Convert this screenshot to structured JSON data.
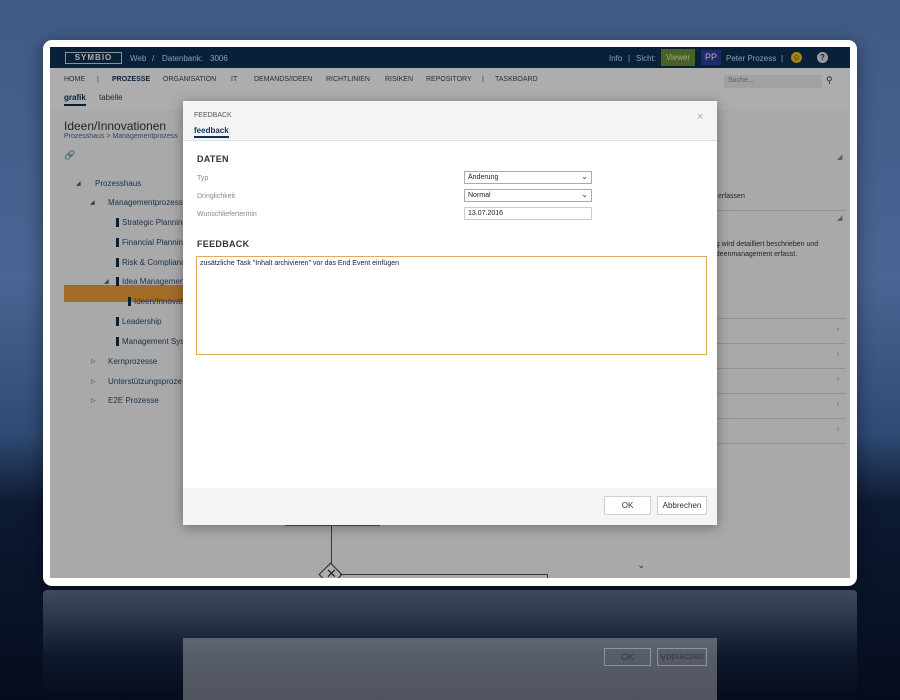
{
  "topbar": {
    "logo": "SYMBIO",
    "web": "Web",
    "separator": "/",
    "database": "Datenbank:",
    "database_id": "3006",
    "info": "Info",
    "view_label": "Sicht:",
    "view_value": "Viewer",
    "user_initials": "PP",
    "user_name": "Peter Prozess",
    "pipe": "|",
    "help": "?"
  },
  "nav": {
    "items": [
      "HOME",
      "PROZESSE",
      "ORGANISATION",
      "IT",
      "DEMANDS/IDEEN",
      "RICHTLINIEN",
      "RISIKEN",
      "REPOSITORY",
      "TASKBOARD"
    ],
    "separator": "|",
    "search_placeholder": "Suche...",
    "subtabs": [
      "grafik",
      "tabelle"
    ]
  },
  "page": {
    "title": "Ideen/Innovationen",
    "breadcrumb": "Prozesshaus > Managementprozess",
    "tree": [
      "Prozesshaus",
      "Managementprozesse",
      "Strategic Planning",
      "Financial Planning",
      "Risk & Compliance",
      "Idea Managemen",
      "Ideen/Innovati",
      "Leadership",
      "Management Sys",
      "Kernprozesse",
      "Unterstützungsproze",
      "E2E Prozesse"
    ],
    "right_panel": [
      "erfassen",
      "ung wird detailliert beschrieben und",
      "n Ideenmanagement erfasst."
    ]
  },
  "dialog": {
    "title": "FEEDBACK",
    "tab": "feedback",
    "close": "×",
    "daten_heading": "DATEN",
    "typ_label": "Typ",
    "typ_value": "Änderung",
    "dringlichkeit_label": "Dringlichkeit",
    "dringlichkeit_value": "Normal",
    "wunschtermin_label": "Wunschliefertermin",
    "wunschtermin_value": "13.07.2016",
    "feedback_heading": "FEEDBACK",
    "feedback_text": "zusätzliche Task \"Inhalt archivieren\" vor das End Event einfügen",
    "ok": "OK",
    "cancel": "Abbrechen"
  }
}
